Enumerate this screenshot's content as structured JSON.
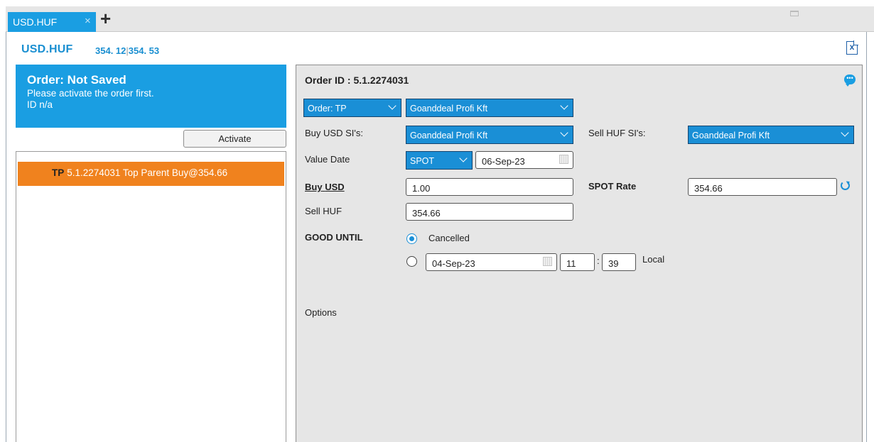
{
  "tabs": [
    {
      "label": "USD.HUF",
      "close": "×"
    }
  ],
  "tab_add": "+",
  "header": {
    "pair": "USD.HUF",
    "bid": "354. 12",
    "separator": "|",
    "ask": "354. 53",
    "export_icon": "x"
  },
  "status": {
    "title": "Order: Not Saved",
    "message": "Please activate the order first.",
    "id_line": "ID n/a"
  },
  "activate_label": "Activate",
  "orders": [
    {
      "type": "TP",
      "text": "5.1.2274031 Top Parent Buy@354.66"
    }
  ],
  "detail": {
    "order_id": "Order ID : 5.1.2274031",
    "order_type": "Order: TP",
    "counterparty": "Goanddeal Profi Kft",
    "buy_si_label": "Buy USD SI's:",
    "buy_si_value": "Goanddeal Profi Kft",
    "sell_si_label": "Sell HUF SI's:",
    "sell_si_value": "Goanddeal Profi Kft",
    "value_date_label": "Value Date",
    "tenor": "SPOT",
    "value_date": "06-Sep-23",
    "buy_label_prefix": "Buy",
    "buy_label_ccy": "USD",
    "buy_amount": "1.00",
    "spot_rate_label": "SPOT Rate",
    "spot_rate": "354.66",
    "sell_label": "Sell HUF",
    "sell_amount": "354.66",
    "good_until_label": "GOOD UNTIL",
    "cancelled_label": "Cancelled",
    "expiry_date": "04-Sep-23",
    "expiry_hour": "11",
    "time_sep": ":",
    "expiry_minute": "39",
    "timezone": "Local",
    "options_label": "Options"
  },
  "colors": {
    "accent": "#1a9ee2",
    "order_highlight": "#f0821e"
  }
}
